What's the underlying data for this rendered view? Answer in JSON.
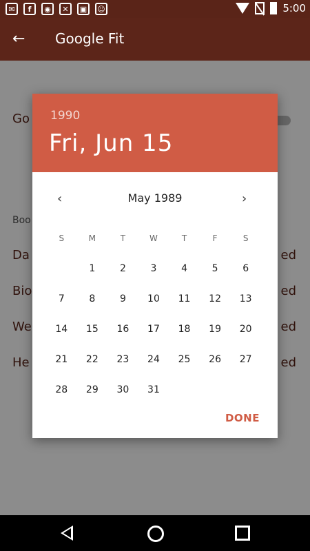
{
  "status_bar": {
    "time": "5:00",
    "icons": [
      "mail-icon",
      "facebook-icon",
      "dash-icon",
      "wrench-icon",
      "lock-icon",
      "android-icon"
    ]
  },
  "app_bar": {
    "title": "Google Fit"
  },
  "background": {
    "rows": [
      {
        "label": "Go",
        "sub": ""
      },
      {
        "label": "",
        "sub": "Boo"
      },
      {
        "label": "Da",
        "right": "ed"
      },
      {
        "label": "Bio",
        "right": "ed"
      },
      {
        "label": "We",
        "right": "ed"
      },
      {
        "label": "He",
        "right": "ed"
      }
    ]
  },
  "date_picker": {
    "header_year": "1990",
    "header_date": "Fri, Jun 15",
    "month_year": "May 1989",
    "weekdays": [
      "S",
      "M",
      "T",
      "W",
      "T",
      "F",
      "S"
    ],
    "weeks": [
      [
        "",
        "1",
        "2",
        "3",
        "4",
        "5",
        "6"
      ],
      [
        "7",
        "8",
        "9",
        "10",
        "11",
        "12",
        "13"
      ],
      [
        "14",
        "15",
        "16",
        "17",
        "18",
        "19",
        "20"
      ],
      [
        "21",
        "22",
        "23",
        "24",
        "25",
        "26",
        "27"
      ],
      [
        "28",
        "29",
        "30",
        "31",
        "",
        "",
        ""
      ]
    ],
    "done_label": "DONE"
  },
  "colors": {
    "header": "#d05c45",
    "app_bar": "#5c2519"
  }
}
